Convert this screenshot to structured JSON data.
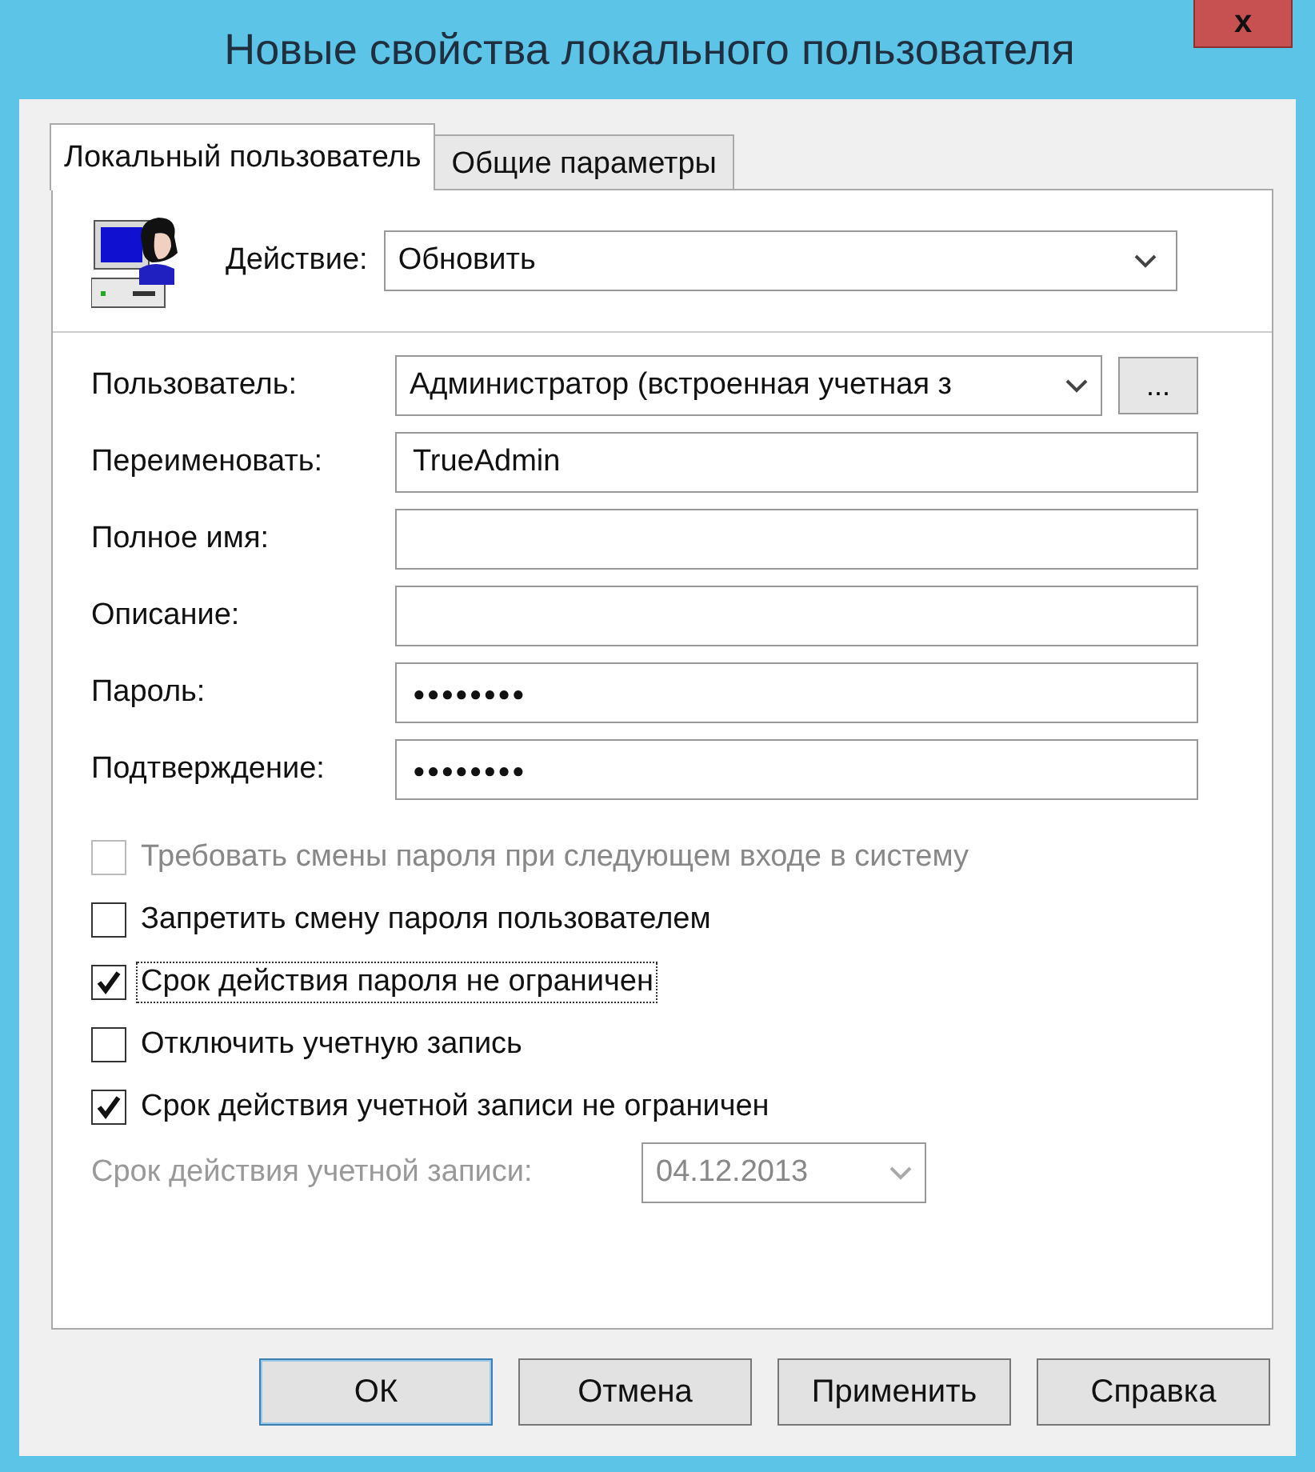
{
  "window": {
    "title": "Новые свойства локального пользователя",
    "close": "x"
  },
  "tabs": [
    {
      "label": "Локальный пользователь",
      "selected": true
    },
    {
      "label": "Общие параметры",
      "selected": false
    }
  ],
  "action": {
    "label": "Действие:",
    "value": "Обновить"
  },
  "fields": [
    {
      "kind": "dropdown",
      "label": "Пользователь:",
      "value": "Администратор (встроенная учетная з",
      "button": "..."
    },
    {
      "kind": "text",
      "label": "Переименовать:",
      "value": "TrueAdmin"
    },
    {
      "kind": "text",
      "label": "Полное имя:"
    },
    {
      "kind": "text",
      "label": "Описание:"
    },
    {
      "kind": "password",
      "label": "Пароль:",
      "value": "●●●●●●●●"
    },
    {
      "kind": "password",
      "label": "Подтверждение:",
      "value": "●●●●●●●●"
    }
  ],
  "checkboxes": [
    {
      "label": "Требовать смены пароля при следующем входе в систему",
      "checked": false,
      "disabled": true,
      "focused": false
    },
    {
      "label": "Запретить смену пароля пользователем",
      "checked": false,
      "disabled": false,
      "focused": false
    },
    {
      "label": "Срок действия пароля не ограничен",
      "checked": true,
      "disabled": false,
      "focused": true
    },
    {
      "label": "Отключить учетную запись",
      "checked": false,
      "disabled": false,
      "focused": false
    },
    {
      "label": "Срок действия учетной записи не ограничен",
      "checked": true,
      "disabled": false,
      "focused": false
    }
  ],
  "expiry": {
    "label": "Срок действия учетной записи:",
    "value": "04.12.2013",
    "disabled": true
  },
  "buttons": [
    {
      "label": "ОК",
      "default": true
    },
    {
      "label": "Отмена",
      "default": false
    },
    {
      "label": "Применить",
      "default": false
    },
    {
      "label": "Справка",
      "default": false
    }
  ]
}
